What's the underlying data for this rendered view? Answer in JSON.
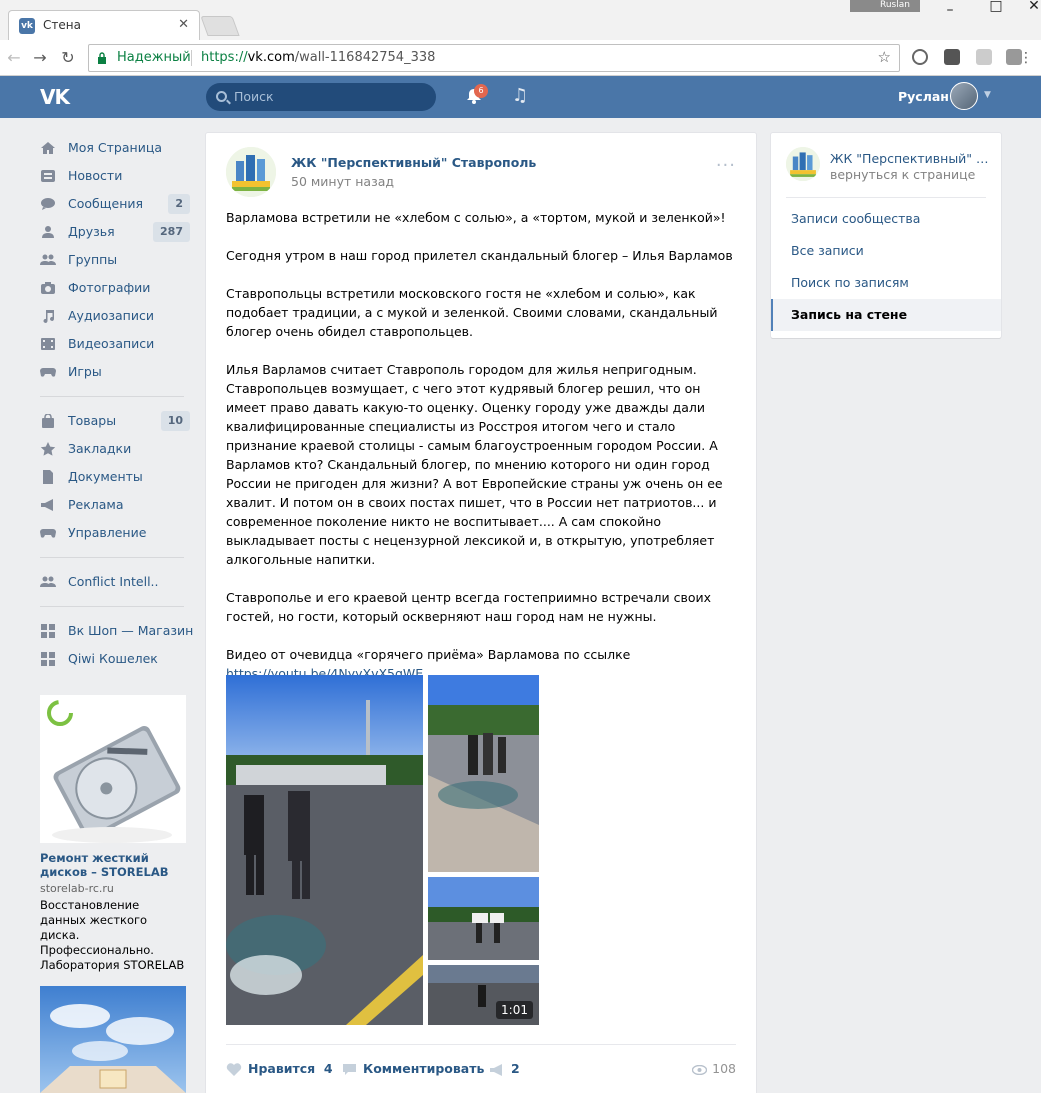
{
  "browser": {
    "tab_title": "Стена",
    "tab_close": "✕",
    "profile_name": "Ruslan",
    "secure_label": "Надежный",
    "url_scheme": "https://",
    "url_host": "vk.com",
    "url_path": "/wall-116842754_338"
  },
  "header": {
    "logo": "VK",
    "search_placeholder": "Поиск",
    "notifications_count": "6",
    "user_name": "Руслан"
  },
  "leftnav": {
    "items": [
      {
        "label": "Моя Страница",
        "icon": "home-icon"
      },
      {
        "label": "Новости",
        "icon": "news-icon"
      },
      {
        "label": "Сообщения",
        "icon": "messages-icon",
        "badge": "2"
      },
      {
        "label": "Друзья",
        "icon": "friends-icon",
        "badge": "287"
      },
      {
        "label": "Группы",
        "icon": "groups-icon"
      },
      {
        "label": "Фотографии",
        "icon": "camera-icon"
      },
      {
        "label": "Аудиозаписи",
        "icon": "music-icon"
      },
      {
        "label": "Видеозаписи",
        "icon": "video-icon"
      },
      {
        "label": "Игры",
        "icon": "gamepad-icon"
      }
    ],
    "items2": [
      {
        "label": "Товары",
        "icon": "bag-icon",
        "badge": "10"
      },
      {
        "label": "Закладки",
        "icon": "star-icon"
      },
      {
        "label": "Документы",
        "icon": "document-icon"
      },
      {
        "label": "Реклама",
        "icon": "megaphone-icon"
      },
      {
        "label": "Управление",
        "icon": "gamepad-icon"
      }
    ],
    "items3": [
      {
        "label": "Conflict Intell..",
        "icon": "groups-icon"
      }
    ],
    "items4": [
      {
        "label": "Вк Шоп — Магазин",
        "icon": "app-icon"
      },
      {
        "label": "Qiwi Кошелек",
        "icon": "app-icon"
      }
    ]
  },
  "ad": {
    "title": "Ремонт жесткий дисков – STORELAB",
    "domain": "storelab-rc.ru",
    "text": "Восстановление данных жесткого диска. Профессионально. Лаборатория STORELAB"
  },
  "post": {
    "author": "ЖК \"Перспективный\" Ставрополь",
    "time": "50 минут назад",
    "paragraphs": [
      "Варламова встретили не «хлебом с солью», а «тортом, мукой и зеленкой»!",
      "Сегодня утром в наш город прилетел скандальный блогер – Илья Варламов",
      "Ставропольцы встретили московского гостя не «хлебом и солью», как подобает традиции, а с мукой и зеленкой. Своими словами, скандальный блогер очень обидел ставропольцев.",
      "Илья Варламов считает Ставрополь городом для жилья непригодным. Ставропольцев возмущает, с чего этот кудрявый блогер решил, что он имеет право давать какую-то оценку. Оценку городу уже дважды дали квалифицированные специалисты из Росстроя итогом чего и стало признание краевой столицы - самым благоустроенным городом России. А Варламов кто? Скандальный блогер, по мнению которого ни один город России не пригоден для жизни? А вот Европейские страны уж очень он ее хвалит. И потом он в своих постах пишет, что в России нет патриотов... и современное поколение никто не воспитывает.... А сам спокойно выкладывает посты с нецензурной лексикой и, в открытую, употребляет алкогольные напитки.",
      "Ставрополье и его краевой центр всегда гостеприимно встречали своих гостей, но гости, который оскверняют наш город нам не нужны."
    ],
    "video_line": "Видео от очевидца «горячего приёма» Варламова по ссылке",
    "link": "https://youtu.be/4NyyXvX5qWE",
    "video_duration": "1:01",
    "like_label": "Нравится",
    "like_count": "4",
    "comment_label": "Комментировать",
    "share_count": "2",
    "views_count": "108"
  },
  "right": {
    "community_name": "ЖК \"Перспективный\" Ставрополь",
    "back_label": "вернуться к странице",
    "menu": [
      {
        "label": "Записи сообщества",
        "active": false
      },
      {
        "label": "Все записи",
        "active": false
      },
      {
        "label": "Поиск по записям",
        "active": false
      },
      {
        "label": "Запись на стене",
        "active": true
      }
    ]
  },
  "colors": {
    "vk_blue": "#4a76a8",
    "link": "#2a5885",
    "page_bg": "#edeef0"
  }
}
